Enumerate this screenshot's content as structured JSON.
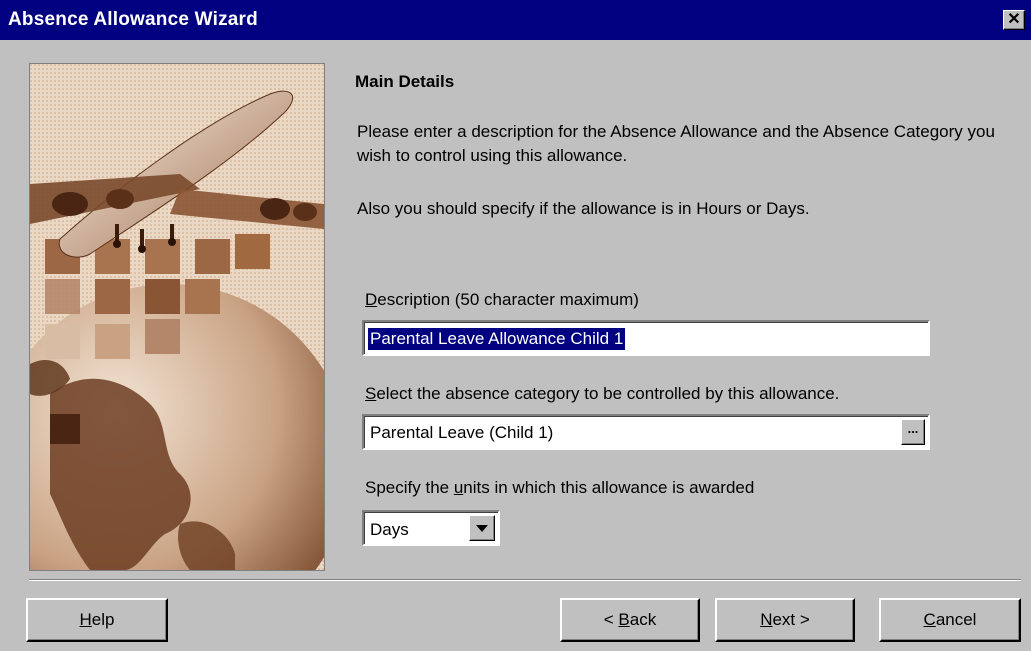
{
  "window": {
    "title": "Absence Allowance Wizard",
    "close_icon": "close-icon"
  },
  "main": {
    "heading": "Main Details",
    "intro_text": "Please enter a description for the Absence Allowance and the Absence Category you wish to control using this allowance.",
    "units_hint": "Also you should specify if the allowance is in Hours or Days."
  },
  "description": {
    "label_accel": "D",
    "label_rest": "escription (50 character maximum)",
    "value": "Parental Leave Allowance Child 1"
  },
  "category": {
    "label_accel": "S",
    "label_rest": "elect the absence category to be controlled by this allowance.",
    "value": "Parental Leave (Child 1)",
    "browse_label": "..."
  },
  "units": {
    "label_before": "Specify the ",
    "label_accel": "u",
    "label_after": "nits in which this allowance is awarded",
    "selected": "Days"
  },
  "buttons": {
    "help_accel": "H",
    "help_rest": "elp",
    "back_prefix": "< ",
    "back_accel": "B",
    "back_rest": "ack",
    "next_accel": "N",
    "next_rest": "ext >",
    "cancel_accel": "C",
    "cancel_rest": "ancel"
  },
  "colors": {
    "titlebar": "#000080",
    "dialog_bg": "#c0c0c0",
    "selection": "#000080",
    "image_tone": "#b07a52"
  }
}
